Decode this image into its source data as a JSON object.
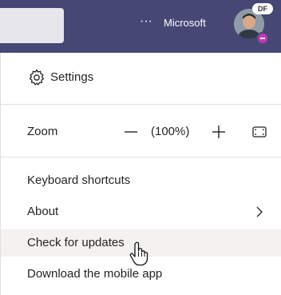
{
  "topbar": {
    "more_label": "···",
    "org_name": "Microsoft",
    "user_initials": "DF",
    "colors": {
      "bar": "#464775",
      "status": "#c239b3"
    }
  },
  "menu": {
    "settings_label": "Settings",
    "zoom": {
      "label": "Zoom",
      "value": "(100%)"
    },
    "items": [
      {
        "label": "Keyboard shortcuts"
      },
      {
        "label": "About"
      },
      {
        "label": "Check for updates"
      },
      {
        "label": "Download the mobile app"
      }
    ]
  },
  "icons": [
    "gear-icon",
    "zoom-out-icon",
    "zoom-in-icon",
    "fit-to-screen-icon",
    "chevron-right-icon",
    "hand-pointer-cursor"
  ]
}
